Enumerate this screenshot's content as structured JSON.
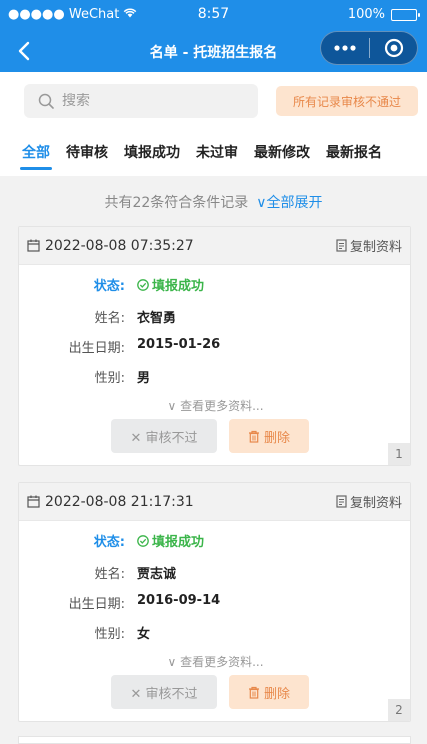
{
  "status_bar": {
    "carrier": "●●●●● WeChat",
    "time": "8:57",
    "battery": "100%"
  },
  "nav": {
    "title": "名单 - 托班招生报名"
  },
  "search": {
    "placeholder": "搜索"
  },
  "reject_all_label": "所有记录审核不通过",
  "tabs": [
    "全部",
    "待审核",
    "填报成功",
    "未过审",
    "最新修改",
    "最新报名"
  ],
  "summary": {
    "text": "共有22条符合条件记录",
    "expand": "∨全部展开"
  },
  "labels": {
    "status": "状态:",
    "name": "姓名:",
    "birth": "出生日期:",
    "gender": "性别:",
    "copy": "复制资料",
    "more": "∨ 查看更多资料...",
    "reject": "✕ 审核不过",
    "delete": "删除"
  },
  "records": [
    {
      "time": "2022-08-08 07:35:27",
      "status": "填报成功",
      "name": "衣智勇",
      "birth": "2015-01-26",
      "gender": "男",
      "index": "1"
    },
    {
      "time": "2022-08-08 21:17:31",
      "status": "填报成功",
      "name": "贾志诚",
      "birth": "2016-09-14",
      "gender": "女",
      "index": "2"
    }
  ],
  "colors": {
    "primary": "#1f8ee8",
    "success": "#3bb54a",
    "warn_bg": "#fde4cf",
    "warn_text": "#e8884a"
  }
}
